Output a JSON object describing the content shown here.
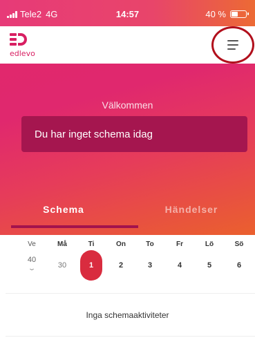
{
  "status_bar": {
    "carrier": "Tele2",
    "network": "4G",
    "time": "14:57",
    "battery": "40 %",
    "battery_level": 0.4
  },
  "header": {
    "logo_text": "edlevo",
    "menu_icon": "hamburger-menu-icon"
  },
  "hero": {
    "welcome": "Välkommen",
    "schedule_message": "Du har inget schema idag"
  },
  "tabs": [
    {
      "label": "Schema",
      "active": true
    },
    {
      "label": "Händelser",
      "active": false
    }
  ],
  "week": {
    "week_label": "Ve",
    "week_number": "40",
    "days": [
      {
        "name": "Må",
        "date": "30",
        "today": false
      },
      {
        "name": "Ti",
        "date": "1",
        "today": true
      },
      {
        "name": "On",
        "date": "2",
        "today": false
      },
      {
        "name": "To",
        "date": "3",
        "today": false
      },
      {
        "name": "Fr",
        "date": "4",
        "today": false
      },
      {
        "name": "Lö",
        "date": "5",
        "today": false
      },
      {
        "name": "Sö",
        "date": "6",
        "today": false
      }
    ]
  },
  "empty_state": "Inga schemaaktiviteter",
  "colors": {
    "brand": "#e02a6e",
    "today": "#d92c3f",
    "card": "#a5164f",
    "annotation_circle": "#b10f1c"
  }
}
